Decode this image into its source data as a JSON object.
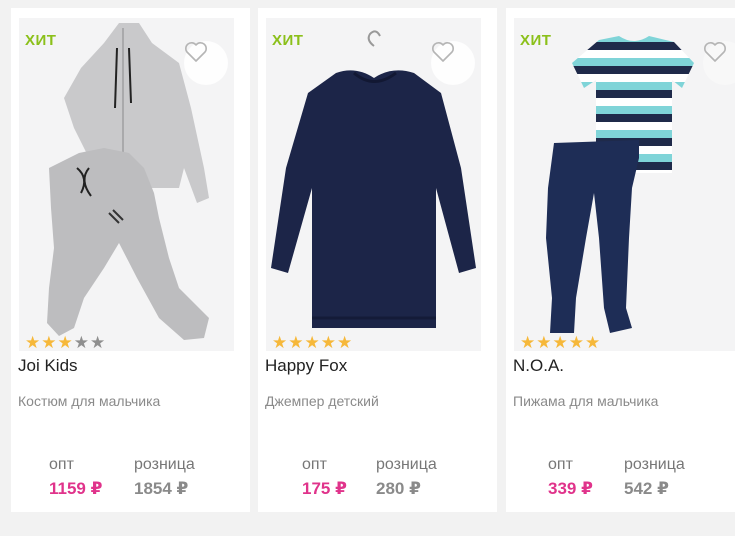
{
  "colors": {
    "hit": "#8bc01a",
    "opt_price": "#e0338b",
    "star_on": "#f6b83a",
    "star_off": "#8f8f8f"
  },
  "icons": {
    "favorite": "heart-outline-icon",
    "rating": "star-icon"
  },
  "products": [
    {
      "badge": "ХИТ",
      "rating": 3,
      "brand": "Joi Kids",
      "description": "Костюм для мальчика",
      "opt_label": "опт",
      "opt_price": "1159 ₽",
      "retail_label": "розница",
      "retail_price": "1854 ₽"
    },
    {
      "badge": "ХИТ",
      "rating": 5,
      "brand": "Happy Fox",
      "description": "Джемпер детский",
      "opt_label": "опт",
      "opt_price": "175 ₽",
      "retail_label": "розница",
      "retail_price": "280 ₽"
    },
    {
      "badge": "ХИТ",
      "rating": 5,
      "brand": "N.O.A.",
      "description": "Пижама для мальчика",
      "opt_label": "опт",
      "opt_price": "339 ₽",
      "retail_label": "розница",
      "retail_price": "542 ₽"
    }
  ]
}
